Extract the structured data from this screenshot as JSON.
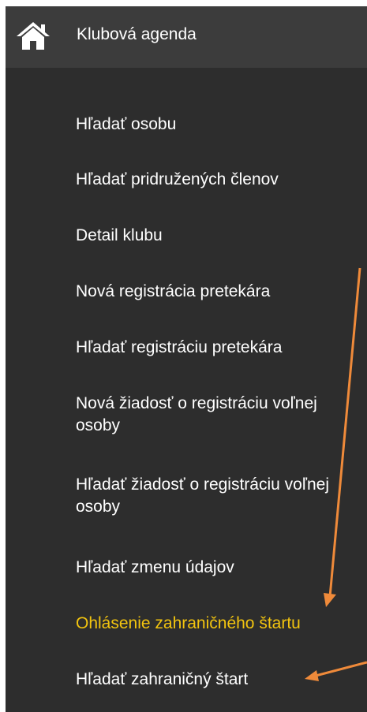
{
  "header": {
    "icon": "home-icon",
    "title": "Klubová agenda"
  },
  "menu": {
    "items": [
      {
        "label": "Hľadať osobu"
      },
      {
        "label": "Hľadať pridružených členov"
      },
      {
        "label": "Detail klubu"
      },
      {
        "label": "Nová registrácia pretekára"
      },
      {
        "label": "Hľadať registráciu pretekára"
      },
      {
        "label": "Nová žiadosť o registráciu voľnej osoby"
      },
      {
        "label": "Hľadať žiadosť o registráciu voľnej osoby"
      },
      {
        "label": "Hľadať zmenu údajov"
      },
      {
        "label": "Ohlásenie zahraničného štartu"
      },
      {
        "label": "Hľadať zahraničný štart"
      }
    ]
  },
  "colors": {
    "menu_background": "#2d2d2d",
    "header_background": "#3c3c3c",
    "text": "#ffffff",
    "active_text": "#f2c40f",
    "annotation_arrow": "#ef8a3a"
  }
}
